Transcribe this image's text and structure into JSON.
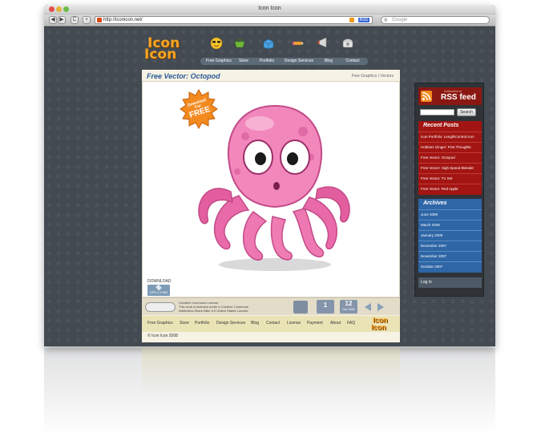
{
  "browser": {
    "title": "Icon Icon",
    "url": "http://iconicon.net/",
    "rss_badge": "RSS",
    "search_placeholder": "Google",
    "nav_back": "◀",
    "nav_forward": "▶",
    "reload": "C",
    "add": "+"
  },
  "site": {
    "logo_line1": "Icon",
    "logo_line2": "Icon",
    "nav": [
      "Free Graphics",
      "Store",
      "Portfolio",
      "Design Services",
      "Blog",
      "Contact"
    ]
  },
  "post": {
    "title": "Free Vector: Octopod",
    "categories": "Free Graphics | Vectors",
    "badge_lines": [
      "Download",
      "For",
      "FREE"
    ],
    "download_label": "DOWNLOAD",
    "download_file": "EPS 1.9 MB",
    "license_text": "Creative Commons License\nThis work is licensed under a Creative Commons Attribution-Share Alike 3.0 United States License.",
    "comments_count": "1",
    "date_day": "12",
    "date_month": "Dec 2008"
  },
  "footer": {
    "nav": [
      "Free Graphics",
      "Store",
      "Portfolio",
      "Design Services",
      "Blog",
      "Contact",
      "License",
      "Payment",
      "About",
      "FAQ"
    ],
    "copyright": "© Icon Icon 2008",
    "logo_line1": "Icon",
    "logo_line2": "Icon"
  },
  "sidebar": {
    "rss_small": "Subscribe to",
    "rss_label": "RSS feed",
    "search_button": "Search",
    "recent_heading": "Recent Posts",
    "recent_posts": [
      "Icon Portfolio: LengthControl Icon",
      "Hobbies Ginger: First Thoughts",
      "Free Vector: Octopod",
      "Free Vector: High Speed Blender",
      "Free Vector: TV Set",
      "Free Vector: Red Apple"
    ],
    "archives_heading": "Archives",
    "archives": [
      "June 2009",
      "March 2009",
      "January 2009",
      "December 2007",
      "November 2007",
      "October 2007"
    ],
    "meta_link": "Log in"
  },
  "colors": {
    "accent_orange": "#f5a623",
    "title_blue": "#2a5a9a",
    "recent_red": "#a21512",
    "archives_blue": "#2e66a6",
    "octopus_pink": "#f07cb4"
  },
  "icons": [
    "sunglasses-smiley-icon",
    "shopping-basket-icon",
    "portfolio-box-icon",
    "pencil-icon",
    "megaphone-icon",
    "telephone-icon"
  ]
}
